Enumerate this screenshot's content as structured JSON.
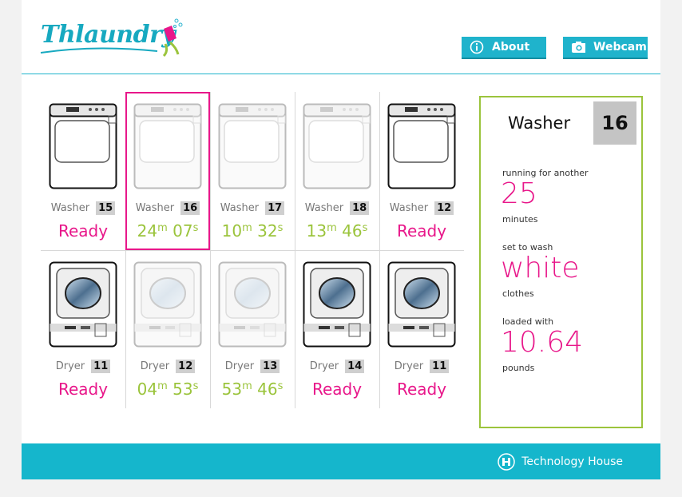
{
  "brand": {
    "logo_text": "Thlaundry"
  },
  "header": {
    "about_label": "About",
    "webcam_label": "Webcam"
  },
  "machines": {
    "row1": [
      {
        "type": "Washer",
        "number": "15",
        "status": "Ready",
        "active": true,
        "selected": false
      },
      {
        "type": "Washer",
        "number": "16",
        "status_m": "24",
        "status_s": "07",
        "active": false,
        "selected": true
      },
      {
        "type": "Washer",
        "number": "17",
        "status_m": "10",
        "status_s": "32",
        "active": false,
        "selected": false
      },
      {
        "type": "Washer",
        "number": "18",
        "status_m": "13",
        "status_s": "46",
        "active": false,
        "selected": false
      },
      {
        "type": "Washer",
        "number": "12",
        "status": "Ready",
        "active": true,
        "selected": false
      }
    ],
    "row2": [
      {
        "type": "Dryer",
        "number": "11",
        "status": "Ready",
        "active": true
      },
      {
        "type": "Dryer",
        "number": "12",
        "status_m": "04",
        "status_s": "53",
        "active": false
      },
      {
        "type": "Dryer",
        "number": "13",
        "status_m": "53",
        "status_s": "46",
        "active": false
      },
      {
        "type": "Dryer",
        "number": "14",
        "status": "Ready",
        "active": true
      },
      {
        "type": "Dryer",
        "number": "11",
        "status": "Ready",
        "active": true
      }
    ],
    "unit_m": "m",
    "unit_s": "s"
  },
  "detail": {
    "title": "Washer",
    "number": "16",
    "running_label": "running for another",
    "running_value": "25",
    "running_unit": "minutes",
    "wash_label": "set to wash",
    "wash_value": "white",
    "wash_unit": "clothes",
    "load_label": "loaded with",
    "load_value": "10.64",
    "load_unit": "pounds"
  },
  "footer": {
    "label": "Technology House"
  },
  "colors": {
    "accent": "#1fb3cc",
    "pink": "#e8178a",
    "green": "#9bc43c"
  },
  "icons": {
    "about": "info-icon",
    "webcam": "camera-icon",
    "footer": "technology-house-logo-icon"
  }
}
